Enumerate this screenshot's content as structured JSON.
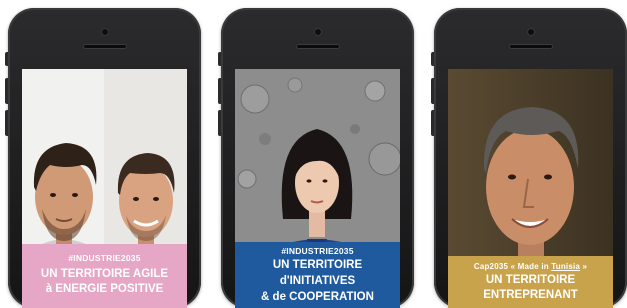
{
  "cards": [
    {
      "tag": "#INDUSTRIE2035",
      "line1": "UN TERRITOIRE AGILE",
      "line2": "à ENERGIE POSITIVE",
      "caption_color": "#e6a6c6",
      "image": "two young men portrait"
    },
    {
      "tag": "#INDUSTRIE2035",
      "line1": "UN TERRITOIRE",
      "line2": "d'INITIATIVES",
      "line3": "& de COOPERATION",
      "caption_color": "#1f5a9e",
      "image": "woman in blue flight suit in front of lunar map"
    },
    {
      "tag_prefix": "Cap2035 « Made in ",
      "tag_underlined": "Tunisia",
      "tag_suffix": " »",
      "line1": "UN TERRITOIRE",
      "line2": "ENTREPRENANT",
      "caption_color": "#c9a24c",
      "image": "smiling man portrait"
    }
  ]
}
